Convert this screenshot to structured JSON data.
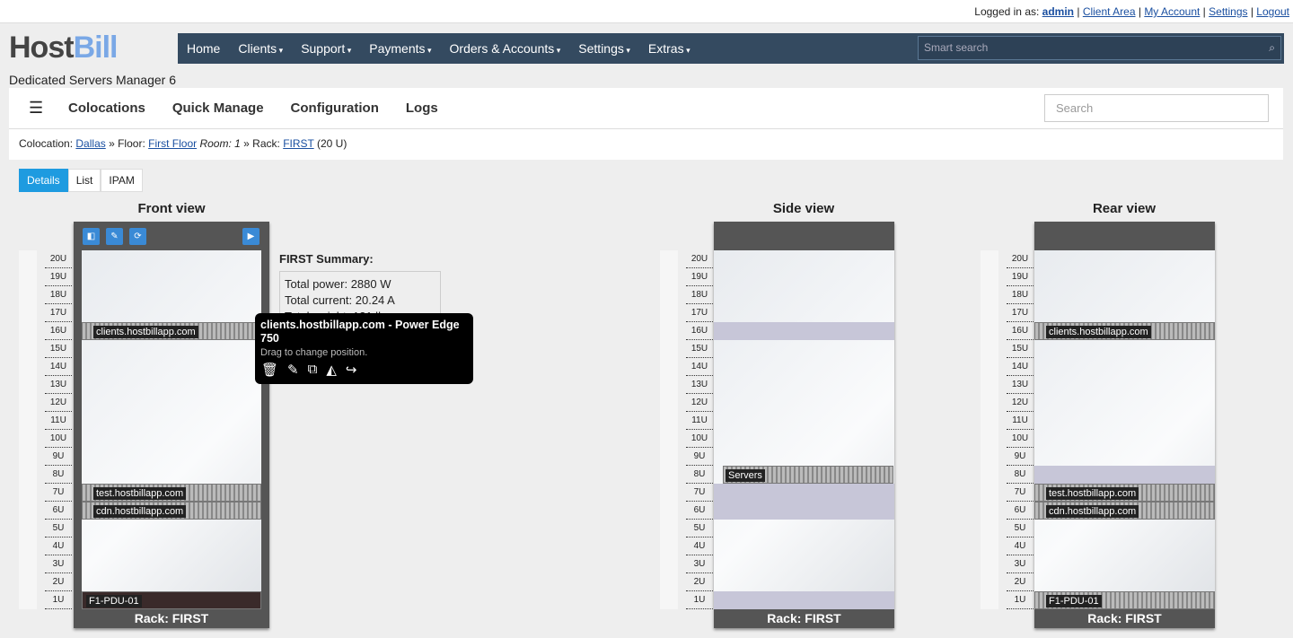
{
  "topbar": {
    "prefix": "Logged in as:",
    "user": "admin",
    "links": [
      "Client Area",
      "My Account",
      "Settings",
      "Logout"
    ]
  },
  "logo": {
    "a": "Host",
    "b": "Bill"
  },
  "nav": {
    "items": [
      {
        "label": "Home",
        "dd": false
      },
      {
        "label": "Clients",
        "dd": true
      },
      {
        "label": "Support",
        "dd": true
      },
      {
        "label": "Payments",
        "dd": true
      },
      {
        "label": "Orders & Accounts",
        "dd": true
      },
      {
        "label": "Settings",
        "dd": true
      },
      {
        "label": "Extras",
        "dd": true
      }
    ],
    "search_placeholder": "Smart search"
  },
  "page_title": "Dedicated Servers Manager 6",
  "subnav": {
    "items": [
      "Colocations",
      "Quick Manage",
      "Configuration",
      "Logs"
    ],
    "search_placeholder": "Search"
  },
  "breadcrumb": {
    "l1": "Colocation:",
    "colo": "Dallas",
    "l2": "» Floor:",
    "floor": "First Floor",
    "room": "Room: 1",
    "l3": "» Rack:",
    "rack": "FIRST",
    "size": "(20 U)"
  },
  "tabs": [
    "Details",
    "List",
    "IPAM"
  ],
  "views": {
    "front": "Front view",
    "side": "Side view",
    "rear": "Rear view",
    "footer": "Rack: FIRST"
  },
  "units": [
    "20U",
    "19U",
    "18U",
    "17U",
    "16U",
    "15U",
    "14U",
    "13U",
    "12U",
    "11U",
    "10U",
    "9U",
    "8U",
    "7U",
    "6U",
    "5U",
    "4U",
    "3U",
    "2U",
    "1U"
  ],
  "devices": {
    "clients": "clients.hostbillapp.com",
    "test": "test.hostbillapp.com",
    "cdn": "cdn.hostbillapp.com",
    "pdu": "F1-PDU-01",
    "servers": "Servers"
  },
  "summary": {
    "title": "FIRST Summary:",
    "power": "Total power: 2880 W",
    "current": "Total current: 20.24 A",
    "weight": "Total weight: 121 lbs"
  },
  "tooltip": {
    "title": "clients.hostbillapp.com - Power Edge 750",
    "hint": "Drag to change position."
  }
}
